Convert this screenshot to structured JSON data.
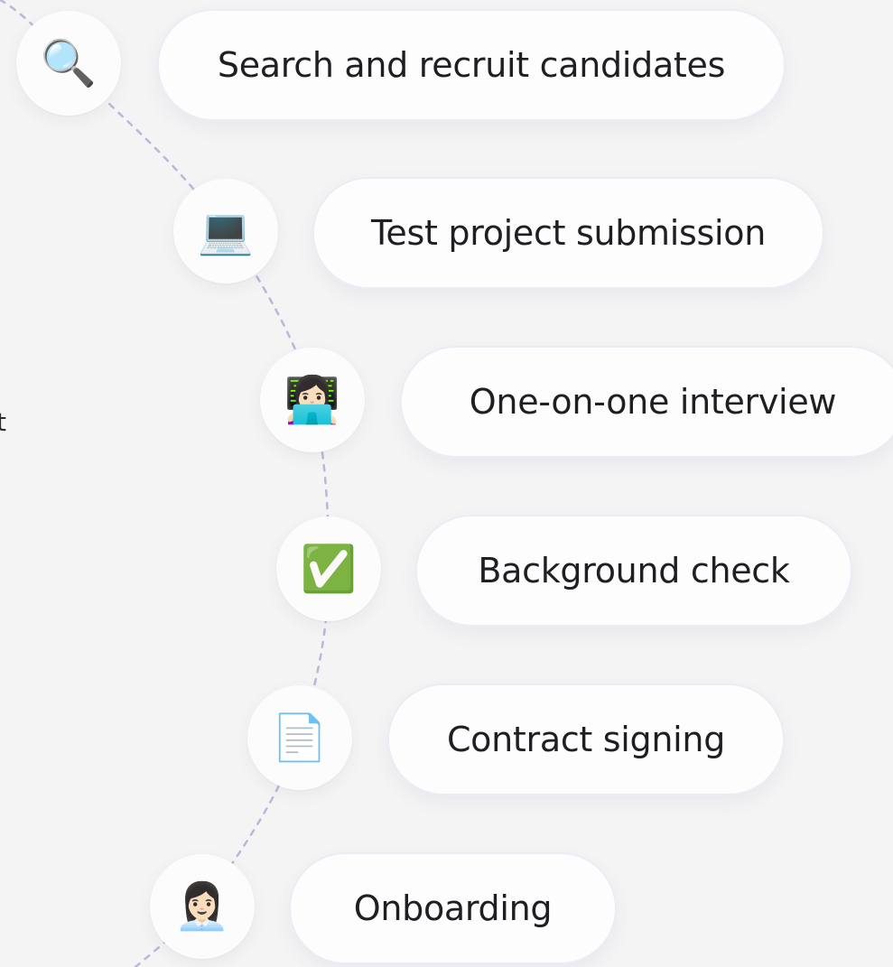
{
  "partial_text": "t",
  "steps": [
    {
      "label": "Search and recruit candidates",
      "icon": "🔍",
      "icon_name": "magnifying-glass-icon"
    },
    {
      "label": "Test project submission",
      "icon": "💻",
      "icon_name": "laptop-icon"
    },
    {
      "label": "One-on-one interview",
      "icon": "👩🏻‍💻",
      "icon_name": "woman-technologist-icon"
    },
    {
      "label": "Background check",
      "icon": "✅",
      "icon_name": "check-mark-button-icon"
    },
    {
      "label": "Contract signing",
      "icon": "📄",
      "icon_name": "document-icon"
    },
    {
      "label": "Onboarding",
      "icon": "👩🏻‍💼",
      "icon_name": "woman-office-worker-icon"
    }
  ],
  "colors": {
    "background": "#f4f4f5",
    "card": "#fdfdfe",
    "dashed_connector": "#b8b8d8",
    "text": "#1e1e23"
  }
}
